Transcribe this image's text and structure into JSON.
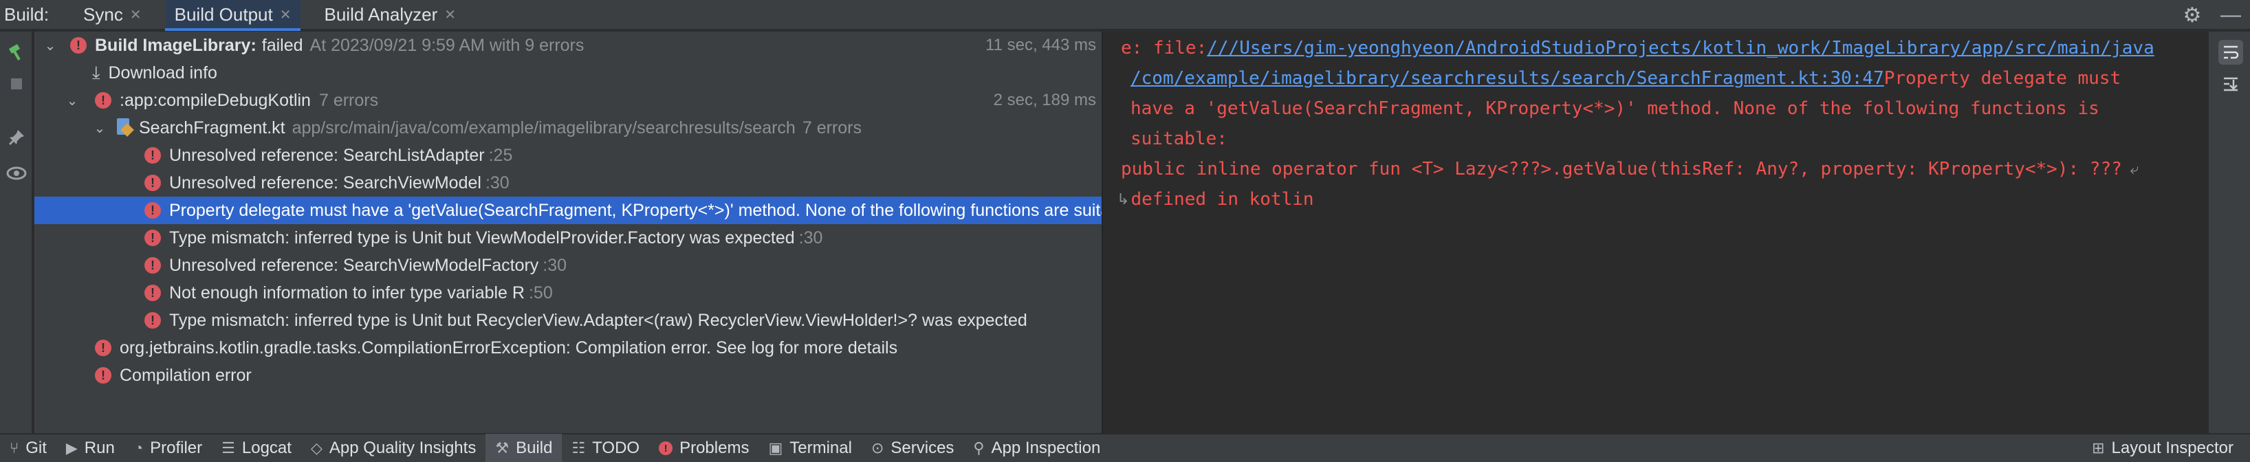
{
  "tabbar": {
    "prefix": "Build:",
    "tabs": [
      {
        "label": "Sync",
        "active": false
      },
      {
        "label": "Build Output",
        "active": true
      },
      {
        "label": "Build Analyzer",
        "active": false
      }
    ],
    "close_glyph": "✕",
    "settings_icon": "gear-icon",
    "minimize_icon": "minimize-icon"
  },
  "tree": {
    "root": {
      "title": "Build ImageLibrary:",
      "status": "failed",
      "detail": "At 2023/09/21 9:59 AM with 9 errors",
      "time": "11 sec, 443 ms"
    },
    "download": {
      "label": "Download info"
    },
    "task": {
      "label": ":app:compileDebugKotlin",
      "count": "7 errors",
      "time": "2 sec, 189 ms"
    },
    "file": {
      "name": "SearchFragment.kt",
      "path": "app/src/main/java/com/example/imagelibrary/searchresults/search",
      "count": "7 errors"
    },
    "errors": [
      {
        "message": "Unresolved reference: SearchListAdapter",
        "line": ":25"
      },
      {
        "message": "Unresolved reference: SearchViewModel",
        "line": ":30"
      },
      {
        "message": "Property delegate must have a 'getValue(SearchFragment, KProperty<*>)' method. None of the following functions are suitable: public inline operator fun <T> Lazy<???>.getValue(thisRef: Any?, property: KProperty<*>): ??? defined in kotlin",
        "line": ""
      },
      {
        "message": "Type mismatch: inferred type is Unit but ViewModelProvider.Factory was expected",
        "line": ":30"
      },
      {
        "message": "Unresolved reference: SearchViewModelFactory",
        "line": ":30"
      },
      {
        "message": "Not enough information to infer type variable R",
        "line": ":50"
      },
      {
        "message": "Type mismatch: inferred type is Unit but RecyclerView.Adapter<(raw) RecyclerView.ViewHolder!>? was expected",
        "line": ""
      }
    ],
    "exception": {
      "message": "org.jetbrains.kotlin.gradle.tasks.CompilationErrorException: Compilation error. See log for more details"
    },
    "compilation": {
      "message": "Compilation error"
    }
  },
  "console": {
    "line1_prefix": "e: file:",
    "link_part1": "///Users/gim-yeonghyeon/AndroidStudioProjects/kotlin_work/ImageLibrary/app/src/main/java",
    "link_part2": "/com/example/imagelibrary/searchresults/search/SearchFragment.kt:30:47",
    "line2_rest": " Property delegate must",
    "line3": "have a 'getValue(SearchFragment, KProperty<*>)' method. None of the following functions is",
    "line4": "suitable:",
    "line5": "public inline operator fun <T> Lazy<???>.getValue(thisRef: Any?, property: KProperty<*>): ???",
    "line6": "defined in kotlin",
    "wrap_glyph_end": "⤶",
    "wrap_glyph_start": "↳"
  },
  "bottombar": {
    "items": [
      {
        "label": "Git",
        "icon": "git-branch-icon"
      },
      {
        "label": "Run",
        "icon": "run-icon"
      },
      {
        "label": "Profiler",
        "icon": "profiler-icon"
      },
      {
        "label": "Logcat",
        "icon": "logcat-icon"
      },
      {
        "label": "App Quality Insights",
        "icon": "app-quality-icon"
      },
      {
        "label": "Build",
        "icon": "hammer-icon",
        "active": true
      },
      {
        "label": "TODO",
        "icon": "todo-list-icon"
      },
      {
        "label": "Problems",
        "icon": "error-icon"
      },
      {
        "label": "Terminal",
        "icon": "terminal-icon"
      },
      {
        "label": "Services",
        "icon": "services-icon"
      },
      {
        "label": "App Inspection",
        "icon": "app-inspection-icon"
      }
    ],
    "right": {
      "label": "Layout Inspector",
      "icon": "layout-inspector-icon"
    }
  },
  "colors": {
    "error_red": "#db5860",
    "selection_blue": "#2f65ca",
    "link_blue": "#589df6",
    "console_red": "#f0524f"
  }
}
